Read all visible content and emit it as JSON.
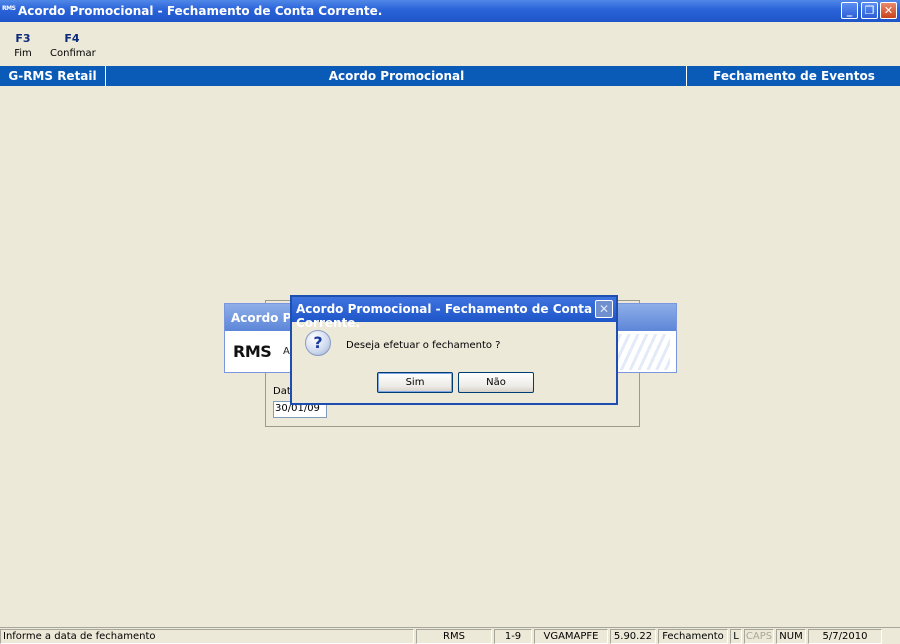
{
  "window": {
    "app_icon_text": "RMS",
    "title": "Acordo Promocional - Fechamento de Conta Corrente.",
    "minimize_glyph": "_",
    "maximize_glyph": "❐",
    "close_glyph": "✕"
  },
  "toolbar": {
    "items": [
      {
        "key": "F3",
        "label": "Fim"
      },
      {
        "key": "F4",
        "label": "Confimar"
      }
    ]
  },
  "header_band": {
    "left": "G-RMS Retail",
    "center": "Acordo Promocional",
    "right": "Fechamento de Eventos"
  },
  "form": {
    "date_label": "Data",
    "date_value": "30/01/09"
  },
  "splash": {
    "title": "Acordo Pro",
    "logo": "RMS",
    "text": "A"
  },
  "dialog": {
    "title": "Acordo Promocional - Fechamento de Conta Corrente.",
    "close_glyph": "✕",
    "icon": "question-icon",
    "icon_glyph": "?",
    "message": "Deseja efetuar o fechamento ?",
    "yes_label": "Sim",
    "no_label": "Não"
  },
  "statusbar": {
    "message": "Informe a data de fechamento",
    "system": "RMS",
    "company": "1-9",
    "user": "VGAMAPFE",
    "version": "5.90.22",
    "module": "Fechamento",
    "l": "L",
    "caps": "CAPS",
    "num": "NUM",
    "date": "5/7/2010"
  },
  "colors": {
    "band": "#0a5bb8",
    "titlebar": "#2a62d9",
    "background": "#ece9d8"
  }
}
